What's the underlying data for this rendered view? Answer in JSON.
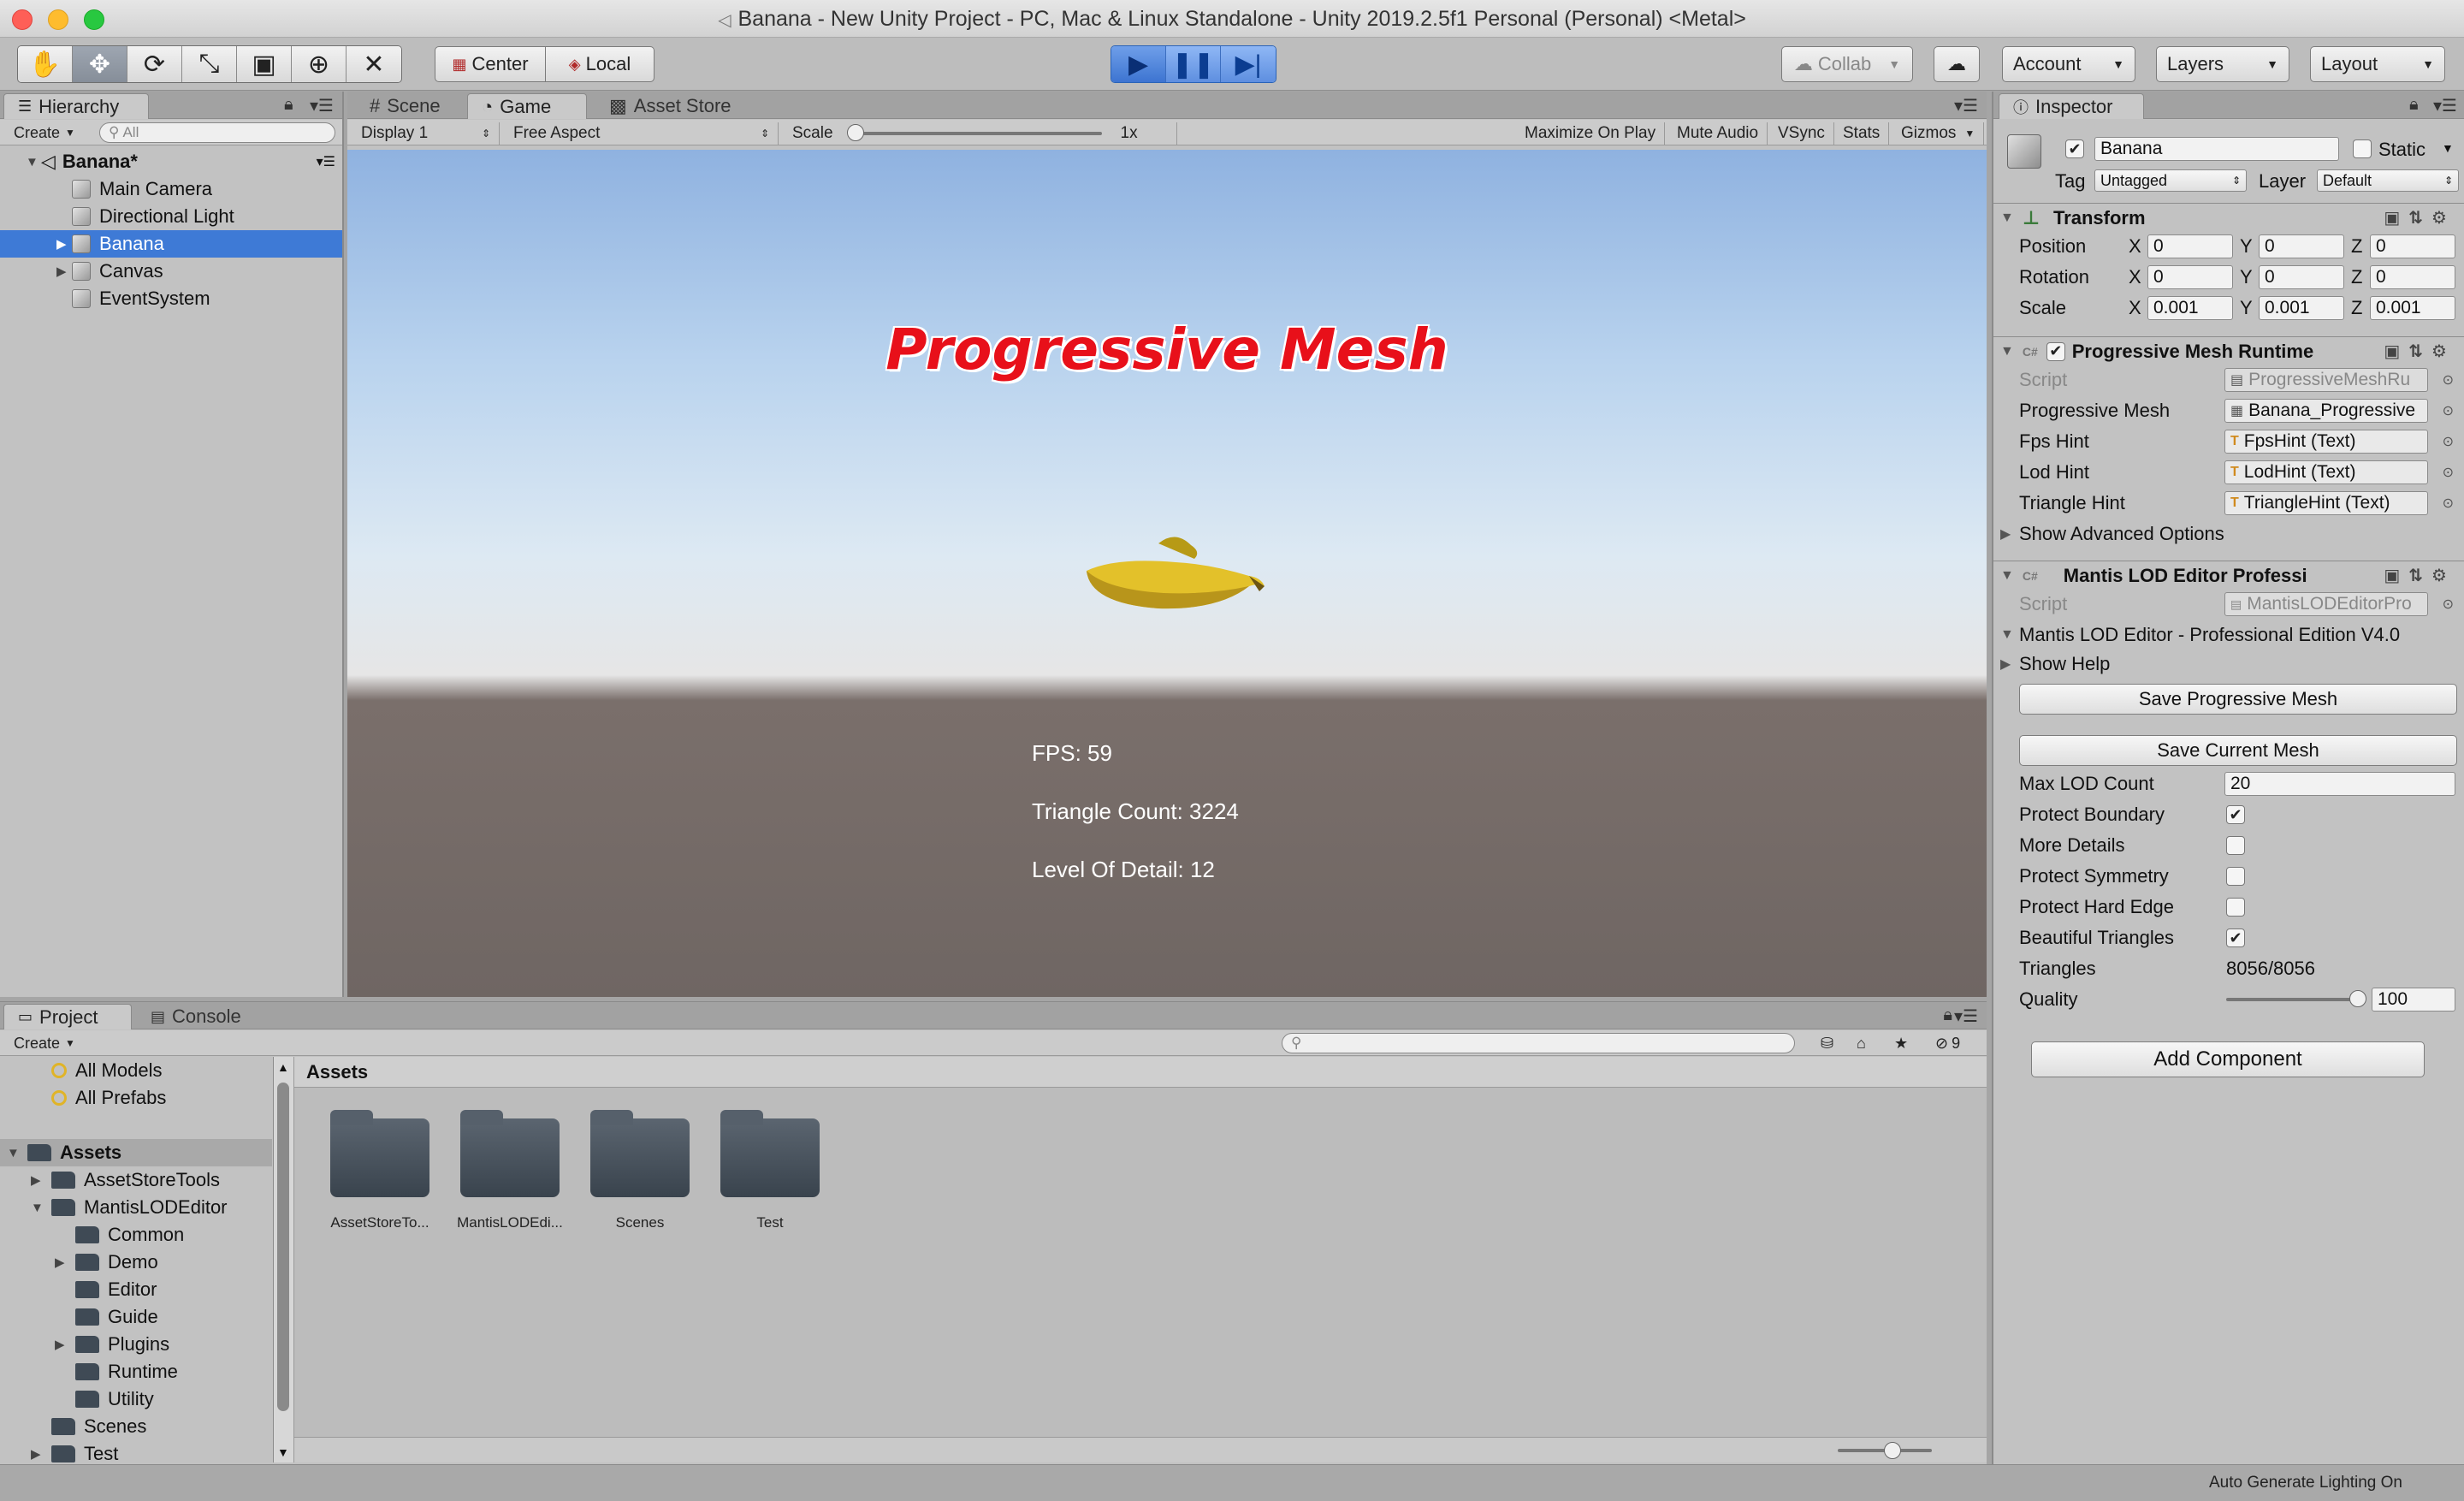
{
  "window": {
    "title": "Banana - New Unity Project - PC, Mac & Linux Standalone - Unity 2019.2.5f1 Personal (Personal) <Metal>"
  },
  "toolbar": {
    "tools": [
      "hand-icon",
      "move-icon",
      "rotate-icon",
      "scale-icon",
      "rect-icon",
      "transform-icon",
      "custom-tool-icon"
    ],
    "pivot": "Center",
    "space": "Local",
    "collab": "Collab",
    "account": "Account",
    "layers": "Layers",
    "layout": "Layout"
  },
  "hierarchy": {
    "tab": "Hierarchy",
    "create": "Create",
    "search_placeholder": "All",
    "scene": "Banana*",
    "items": [
      {
        "label": "Main Camera",
        "expandable": false,
        "selected": false
      },
      {
        "label": "Directional Light",
        "expandable": false,
        "selected": false
      },
      {
        "label": "Banana",
        "expandable": true,
        "selected": true
      },
      {
        "label": "Canvas",
        "expandable": true,
        "selected": false
      },
      {
        "label": "EventSystem",
        "expandable": false,
        "selected": false
      }
    ]
  },
  "game": {
    "tabs": [
      "Scene",
      "Game",
      "Asset Store"
    ],
    "display": "Display 1",
    "aspect": "Free Aspect",
    "scale_label": "Scale",
    "scale_value": "1x",
    "options": [
      "Maximize On Play",
      "Mute Audio",
      "VSync",
      "Stats",
      "Gizmos"
    ],
    "title": "Progressive Mesh",
    "fps": "FPS: 59",
    "triangles": "Triangle Count: 3224",
    "lod": "Level Of Detail: 12"
  },
  "inspector": {
    "tab": "Inspector",
    "object_name": "Banana",
    "static_label": "Static",
    "tag_label": "Tag",
    "tag_value": "Untagged",
    "layer_label": "Layer",
    "layer_value": "Default",
    "transform": {
      "title": "Transform",
      "position_label": "Position",
      "rotation_label": "Rotation",
      "scale_label": "Scale",
      "x": "X",
      "y": "Y",
      "z": "Z",
      "position": [
        "0",
        "0",
        "0"
      ],
      "rotation": [
        "0",
        "0",
        "0"
      ],
      "scale": [
        "0.001",
        "0.001",
        "0.001"
      ]
    },
    "pm_runtime": {
      "title": "Progressive Mesh Runtime",
      "script_label": "Script",
      "script_value": "ProgressiveMeshRu",
      "mesh_label": "Progressive Mesh",
      "mesh_value": "Banana_Progressive",
      "fps_label": "Fps Hint",
      "fps_value": "FpsHint (Text)",
      "lod_label": "Lod Hint",
      "lod_value": "LodHint (Text)",
      "tri_label": "Triangle Hint",
      "tri_value": "TriangleHint (Text)",
      "advanced": "Show Advanced Options"
    },
    "mantis": {
      "title": "Mantis LOD Editor Professi",
      "script_label": "Script",
      "script_value": "MantisLODEditorPro",
      "edition": "Mantis LOD Editor - Professional Edition V4.0",
      "help": "Show Help",
      "save_progressive": "Save Progressive Mesh",
      "save_current": "Save Current Mesh",
      "max_lod_label": "Max LOD Count",
      "max_lod_value": "20",
      "protect_boundary": "Protect Boundary",
      "more_details": "More Details",
      "protect_symmetry": "Protect Symmetry",
      "protect_hard_edge": "Protect Hard Edge",
      "beautiful_triangles": "Beautiful Triangles",
      "triangles_label": "Triangles",
      "triangles_value": "8056/8056",
      "quality_label": "Quality",
      "quality_value": "100",
      "quality_fraction": 1.0,
      "checks": {
        "protect_boundary": true,
        "more_details": false,
        "protect_symmetry": false,
        "protect_hard_edge": false,
        "beautiful_triangles": true
      }
    },
    "add_component": "Add Component"
  },
  "project": {
    "tabs": [
      "Project",
      "Console"
    ],
    "create": "Create",
    "hidden_count": "9",
    "favorites": [
      "All Models",
      "All Prefabs"
    ],
    "tree": [
      {
        "label": "Assets",
        "indent": 0,
        "expand": "open",
        "header": true
      },
      {
        "label": "AssetStoreTools",
        "indent": 1,
        "expand": "closed"
      },
      {
        "label": "MantisLODEditor",
        "indent": 1,
        "expand": "open"
      },
      {
        "label": "Common",
        "indent": 2,
        "expand": "none"
      },
      {
        "label": "Demo",
        "indent": 2,
        "expand": "closed"
      },
      {
        "label": "Editor",
        "indent": 2,
        "expand": "none"
      },
      {
        "label": "Guide",
        "indent": 2,
        "expand": "none"
      },
      {
        "label": "Plugins",
        "indent": 2,
        "expand": "closed"
      },
      {
        "label": "Runtime",
        "indent": 2,
        "expand": "none"
      },
      {
        "label": "Utility",
        "indent": 2,
        "expand": "none"
      },
      {
        "label": "Scenes",
        "indent": 1,
        "expand": "none"
      },
      {
        "label": "Test",
        "indent": 1,
        "expand": "closed"
      }
    ],
    "breadcrumb": "Assets",
    "assets": [
      "AssetStoreTo...",
      "MantisLODEdi...",
      "Scenes",
      "Test"
    ]
  },
  "status": {
    "text": "Auto Generate Lighting On"
  }
}
